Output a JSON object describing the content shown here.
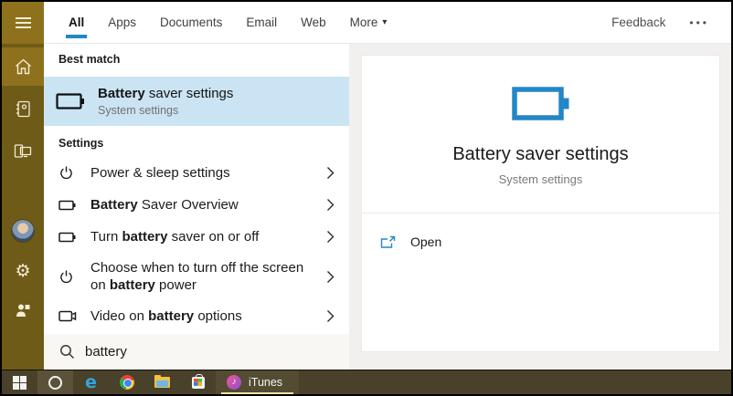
{
  "colors": {
    "accent": "#2387c6",
    "best_match_bg": "#cbe4f3",
    "sidebar": "#6e5b17",
    "sidebar_highlight": "#8e711c",
    "taskbar": "#49412a"
  },
  "topbar": {
    "tabs": [
      {
        "label": "All",
        "active": true
      },
      {
        "label": "Apps",
        "active": false
      },
      {
        "label": "Documents",
        "active": false
      },
      {
        "label": "Email",
        "active": false
      },
      {
        "label": "Web",
        "active": false
      },
      {
        "label": "More",
        "active": false
      }
    ],
    "chevron_down_icon": "▾",
    "feedback_label": "Feedback",
    "ellipsis_icon": "•••"
  },
  "results": {
    "best_match_header": "Best match",
    "best_match": {
      "title_segments": [
        {
          "t": "Battery",
          "b": true
        },
        {
          "t": " saver settings",
          "b": false
        }
      ],
      "subtitle": "System settings"
    },
    "settings_header": "Settings",
    "items": [
      {
        "icon": "power-icon",
        "segments": [
          {
            "t": "Power & sleep settings",
            "b": false
          }
        ]
      },
      {
        "icon": "battery-icon",
        "segments": [
          {
            "t": "Battery",
            "b": true
          },
          {
            "t": " Saver Overview",
            "b": false
          }
        ]
      },
      {
        "icon": "battery-icon",
        "segments": [
          {
            "t": "Turn ",
            "b": false
          },
          {
            "t": "battery",
            "b": true
          },
          {
            "t": " saver on or off",
            "b": false
          }
        ]
      },
      {
        "icon": "power-icon",
        "segments": [
          {
            "t": "Choose when to turn off the screen on ",
            "b": false
          },
          {
            "t": "battery",
            "b": true
          },
          {
            "t": " power",
            "b": false
          }
        ]
      },
      {
        "icon": "video-icon",
        "segments": [
          {
            "t": "Video on ",
            "b": false
          },
          {
            "t": "battery",
            "b": true
          },
          {
            "t": " options",
            "b": false
          }
        ]
      }
    ]
  },
  "search": {
    "query": "battery"
  },
  "preview": {
    "title": "Battery saver settings",
    "subtitle": "System settings",
    "open_label": "Open"
  },
  "taskbar": {
    "itunes_label": "iTunes",
    "music_note_icon": "♪"
  }
}
